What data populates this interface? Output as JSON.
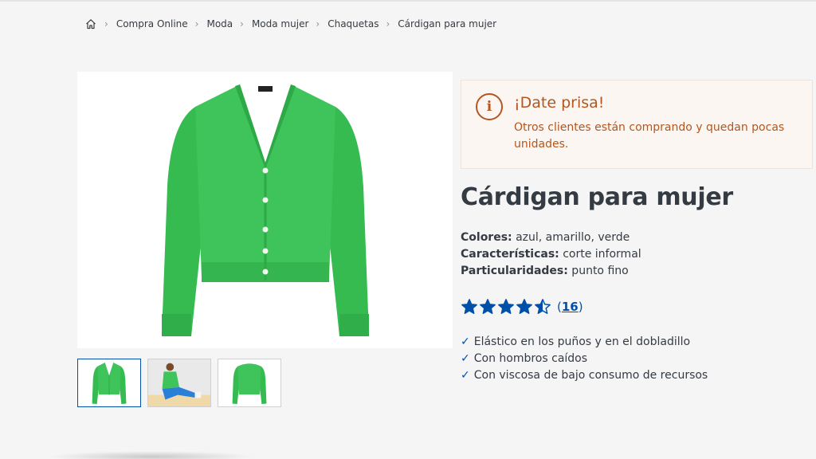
{
  "breadcrumb": {
    "home_icon": "home-icon",
    "separator": "›",
    "items": [
      "Compra Online",
      "Moda",
      "Moda mujer",
      "Chaquetas",
      "Cárdigan para mujer"
    ]
  },
  "product": {
    "title": "Cárdigan para mujer",
    "color_hex": "#3ec45a",
    "attributes": [
      {
        "key": "Colores:",
        "value": " azul, amarillo, verde"
      },
      {
        "key": "Características:",
        "value": " corte informal"
      },
      {
        "key": "Particularidades:",
        "value": " punto fino"
      }
    ],
    "rating": {
      "stars": 4.5,
      "max": 5,
      "count_open": "(",
      "count": "16",
      "count_close": ")"
    },
    "features": [
      "Elástico en los puños y en el dobladillo",
      "Con hombros caídos",
      "Con viscosa de bajo consumo de recursos"
    ],
    "check_glyph": "✓"
  },
  "hurry": {
    "icon": "info-icon",
    "icon_glyph": "i",
    "title": "¡Date prisa!",
    "text": "Otros clientes están comprando y quedan pocas unidades."
  },
  "colors": {
    "accent_blue": "#0050aa",
    "hurry_orange": "#b4561e",
    "text": "#353b42"
  }
}
